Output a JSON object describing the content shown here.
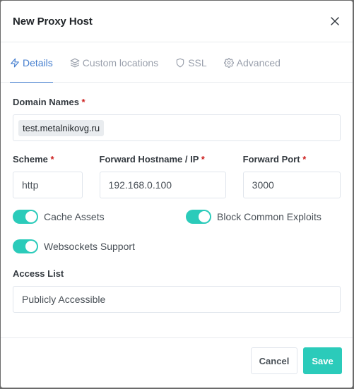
{
  "modal": {
    "title": "New Proxy Host",
    "close_icon": "close-icon"
  },
  "tabs": [
    {
      "label": "Details",
      "icon": "zap-icon",
      "active": true
    },
    {
      "label": "Custom locations",
      "icon": "layers-icon",
      "active": false
    },
    {
      "label": "SSL",
      "icon": "shield-icon",
      "active": false
    },
    {
      "label": "Advanced",
      "icon": "gear-icon",
      "active": false
    }
  ],
  "form": {
    "domain_names": {
      "label": "Domain Names",
      "required": "*",
      "values": [
        "test.metalnikovg.ru"
      ]
    },
    "scheme": {
      "label": "Scheme",
      "required": "*",
      "value": "http"
    },
    "forward_host": {
      "label": "Forward Hostname / IP",
      "required": "*",
      "value": "192.168.0.100"
    },
    "forward_port": {
      "label": "Forward Port",
      "required": "*",
      "value": "3000"
    },
    "toggles": [
      {
        "label": "Cache Assets",
        "checked": true
      },
      {
        "label": "Block Common Exploits",
        "checked": true
      },
      {
        "label": "Websockets Support",
        "checked": true
      }
    ],
    "access_list": {
      "label": "Access List",
      "value": "Publicly Accessible"
    }
  },
  "footer": {
    "cancel_label": "Cancel",
    "save_label": "Save"
  },
  "colors": {
    "accent": "#467fcf",
    "teal": "#2bcbba",
    "required": "#cd201f"
  }
}
